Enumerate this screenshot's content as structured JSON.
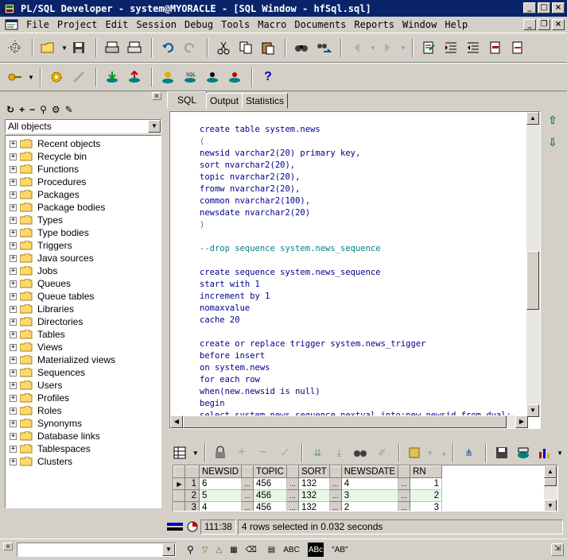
{
  "window": {
    "title": "PL/SQL Developer - system@MYORACLE - [SQL Window - hfSql.sql]",
    "controls": {
      "minimize": "_",
      "maximize": "□",
      "close": "×"
    }
  },
  "menu": {
    "items": [
      "File",
      "Project",
      "Edit",
      "Session",
      "Debug",
      "Tools",
      "Macro",
      "Documents",
      "Reports",
      "Window",
      "Help"
    ],
    "mdi_controls": {
      "minimize": "_",
      "restore": "❐",
      "close": "×"
    }
  },
  "browser": {
    "filter_value": "All objects",
    "items": [
      "Recent objects",
      "Recycle bin",
      "Functions",
      "Procedures",
      "Packages",
      "Package bodies",
      "Types",
      "Type bodies",
      "Triggers",
      "Java sources",
      "Jobs",
      "Queues",
      "Queue tables",
      "Libraries",
      "Directories",
      "Tables",
      "Views",
      "Materialized views",
      "Sequences",
      "Users",
      "Profiles",
      "Roles",
      "Synonyms",
      "Database links",
      "Tablespaces",
      "Clusters"
    ]
  },
  "tabs": [
    "SQL",
    "Output",
    "Statistics"
  ],
  "editor": {
    "lines": [
      {
        "text": "create table system.news",
        "kind": "code"
      },
      {
        "text": "(",
        "kind": "muted"
      },
      {
        "text": "newsid varchar2(20) primary key,",
        "kind": "code"
      },
      {
        "text": "sort nvarchar2(20),",
        "kind": "code"
      },
      {
        "text": "topic nvarchar2(20),",
        "kind": "code"
      },
      {
        "text": "fromw nvarchar2(20),",
        "kind": "code"
      },
      {
        "text": "common nvarchar2(100),",
        "kind": "code"
      },
      {
        "text": "newsdate nvarchar2(20)",
        "kind": "code"
      },
      {
        "text": ")",
        "kind": "muted"
      },
      {
        "text": "",
        "kind": "code"
      },
      {
        "text": "--drop sequence system.news_sequence",
        "kind": "comment"
      },
      {
        "text": "",
        "kind": "code"
      },
      {
        "text": "create sequence system.news_sequence",
        "kind": "code"
      },
      {
        "text": "start with 1",
        "kind": "code"
      },
      {
        "text": "increment by 1",
        "kind": "code"
      },
      {
        "text": "nomaxvalue",
        "kind": "code"
      },
      {
        "text": "cache 20",
        "kind": "code"
      },
      {
        "text": "",
        "kind": "code"
      },
      {
        "text": "create or replace trigger system.news_trigger",
        "kind": "code"
      },
      {
        "text": "before insert",
        "kind": "code"
      },
      {
        "text": "on system.news",
        "kind": "code"
      },
      {
        "text": "for each row",
        "kind": "code"
      },
      {
        "text": "when(new.newsid is null)",
        "kind": "code"
      },
      {
        "text": "begin",
        "kind": "code"
      },
      {
        "text": "select system.news_sequence.nextval into:new.newsid from dual;",
        "kind": "code"
      }
    ]
  },
  "results": {
    "columns": [
      "NEWSID",
      "TOPIC",
      "SORT",
      "NEWSDATE",
      "RN"
    ],
    "rows": [
      {
        "num": "1",
        "newsid": "6",
        "topic": "456",
        "sort": "132",
        "newsdate": "4",
        "rn": "1"
      },
      {
        "num": "2",
        "newsid": "5",
        "topic": "456",
        "sort": "132",
        "newsdate": "3",
        "rn": "2"
      },
      {
        "num": "3",
        "newsid": "4",
        "topic": "456",
        "sort": "132",
        "newsdate": "2",
        "rn": "3"
      }
    ],
    "ellipsis": "..."
  },
  "status": {
    "cursor": "111:38",
    "message": "4 rows selected in 0.032 seconds"
  },
  "findbar": {
    "value": "",
    "abc_label": "ABC",
    "abc_boxed_label": "ABc",
    "quote_label": "\"AB\""
  },
  "colors": {
    "title_bg": "#0a246a",
    "sql_text": "#00008b",
    "comment_text": "#008080",
    "row_highlight": "#e8f8e8"
  }
}
